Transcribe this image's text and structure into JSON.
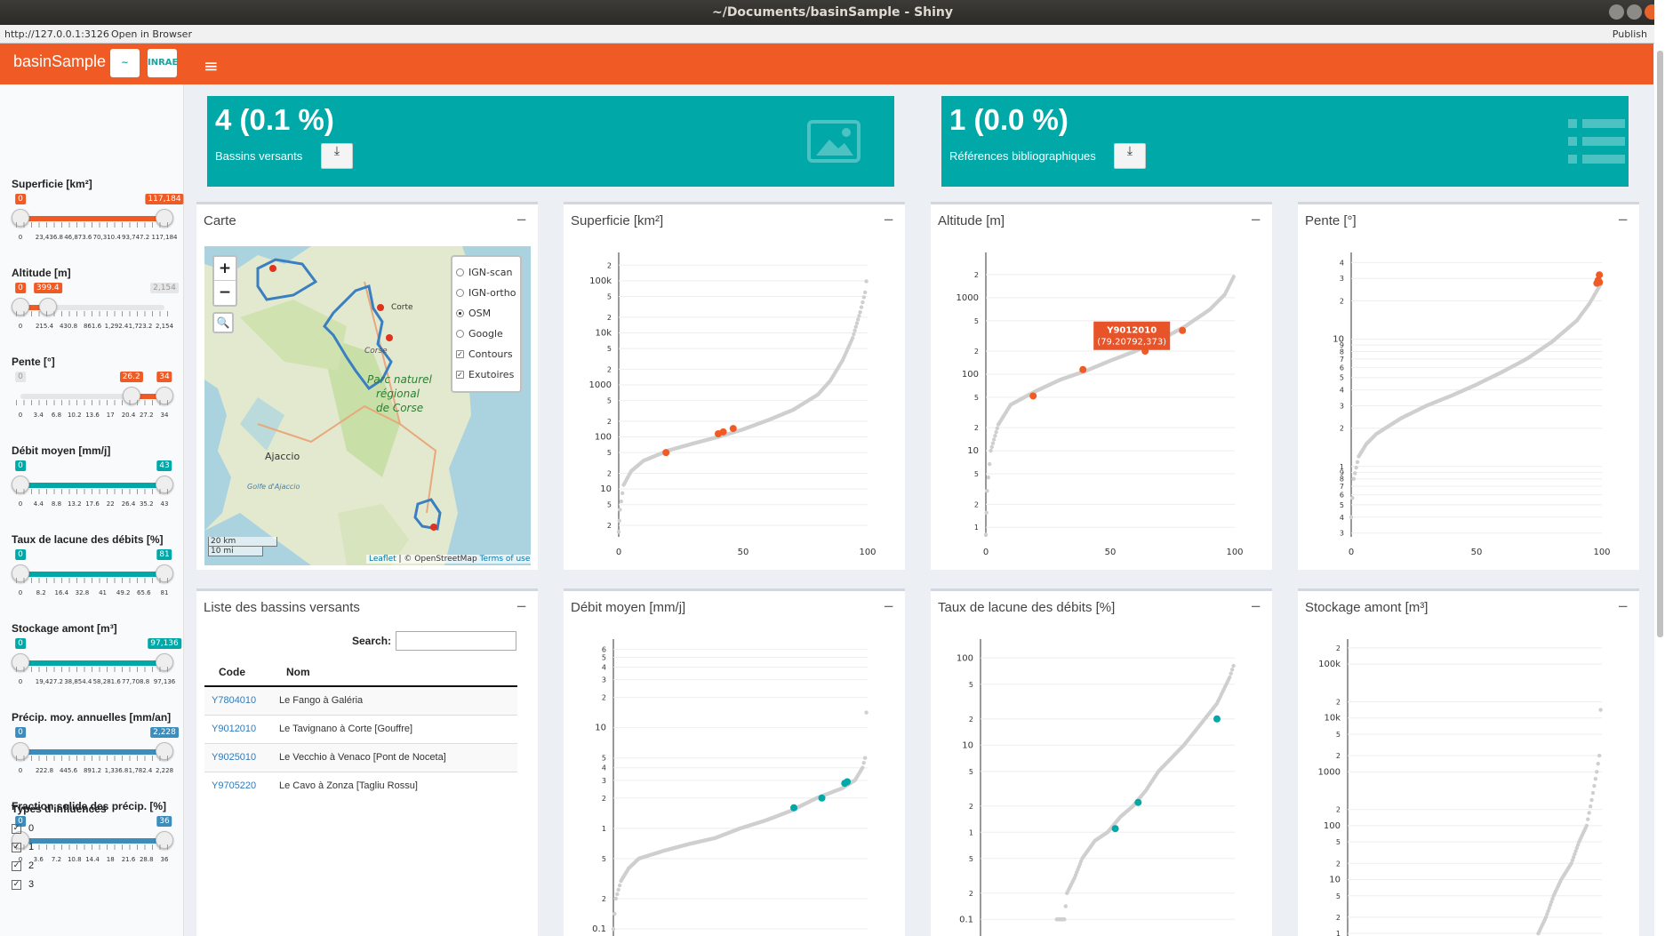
{
  "window": {
    "title": "~/Documents/basinSample - Shiny",
    "url": "http://127.0.0.1:3126",
    "open_in_browser": "Open in Browser",
    "publish": "Publish"
  },
  "header": {
    "app_name": "basinSample",
    "logo1": "~",
    "logo2": "INRAE"
  },
  "sidebar": {
    "sliders": [
      {
        "label": "Superficie [km²]",
        "low": "0",
        "high": "117,184",
        "ticks": [
          "0",
          "23,436.8",
          "46,873.6",
          "70,310.4",
          "93,747.2",
          "117,184"
        ],
        "from": 0,
        "to": 1,
        "color": "#f05a24"
      },
      {
        "label": "Altitude [m]",
        "low": "0",
        "high": "399.4",
        "max_label": "2,154",
        "ticks": [
          "0",
          "215.4",
          "430.8",
          "861.6",
          "1,292.4",
          "1,723.2",
          "2,154"
        ],
        "from": 0,
        "to": 0.19,
        "color": "#f05a24"
      },
      {
        "label": "Pente [°]",
        "low": "26.2",
        "high": "34",
        "min_label": "0",
        "ticks": [
          "0",
          "3.4",
          "6.8",
          "10.2",
          "13.6",
          "17",
          "20.4",
          "27.2",
          "34"
        ],
        "from": 0.77,
        "to": 1,
        "color": "#f05a24"
      },
      {
        "label": "Débit moyen [mm/j]",
        "low": "0",
        "high": "43",
        "ticks": [
          "0",
          "4.4",
          "8.8",
          "13.2",
          "17.6",
          "22",
          "26.4",
          "35.2",
          "43"
        ],
        "from": 0,
        "to": 1,
        "color": "#00a8a8"
      },
      {
        "label": "Taux de lacune des débits [%]",
        "low": "0",
        "high": "81",
        "ticks": [
          "0",
          "8.2",
          "16.4",
          "32.8",
          "41",
          "49.2",
          "65.6",
          "81"
        ],
        "from": 0,
        "to": 1,
        "color": "#00a8a8"
      },
      {
        "label": "Stockage amont [m³]",
        "low": "0",
        "high": "97,136",
        "ticks": [
          "0",
          "19,427.2",
          "38,854.4",
          "58,281.6",
          "77,708.8",
          "97,136"
        ],
        "from": 0,
        "to": 1,
        "color": "#00a8a8"
      },
      {
        "label": "Précip. moy. annuelles [mm/an]",
        "low": "0",
        "high": "2,228",
        "ticks": [
          "0",
          "222.8",
          "445.6",
          "891.2",
          "1,336.8",
          "1,782.4",
          "2,228"
        ],
        "from": 0,
        "to": 1,
        "color": "#3c8dbc"
      },
      {
        "label": "Fraction solide des précip. [%]",
        "low": "0",
        "high": "36",
        "ticks": [
          "0",
          "3.6",
          "7.2",
          "10.8",
          "14.4",
          "18",
          "21.6",
          "28.8",
          "36"
        ],
        "from": 0,
        "to": 1,
        "color": "#3c8dbc"
      }
    ],
    "influences": {
      "label": "Types d'influences",
      "options": [
        "0",
        "1",
        "2",
        "3"
      ]
    }
  },
  "value_boxes": [
    {
      "value": "4 (0.1 %)",
      "subtitle": "Bassins versants"
    },
    {
      "value": "1 (0.0 %)",
      "subtitle": "Références bibliographiques"
    }
  ],
  "map": {
    "title": "Carte",
    "layers": [
      "IGN-scan",
      "IGN-ortho",
      "OSM",
      "Google"
    ],
    "selected": "OSM",
    "overlays": [
      "Contours",
      "Exutoires"
    ],
    "places": [
      "Corse",
      "Parc naturel",
      "régional",
      "de Corse",
      "Ajaccio",
      "Golfe d'Ajaccio",
      "Corte"
    ],
    "scale_km": "20 km",
    "scale_mi": "10 mi",
    "attr_leaflet": "Leaflet",
    "attr_osm": "| © OpenStreetMap",
    "attr_terms": "Terms of use"
  },
  "table": {
    "title": "Liste des bassins versants",
    "search_label": "Search:",
    "columns": [
      "Code",
      "Nom"
    ],
    "rows": [
      [
        "Y7804010",
        "Le Fango à Galéria"
      ],
      [
        "Y9012010",
        "Le Tavignano à Corte [Gouffre]"
      ],
      [
        "Y9025010",
        "Le Vecchio à Venaco [Pont de Noceta]"
      ],
      [
        "Y9705220",
        "Le Cavo à Zonza [Tagliu Rossu]"
      ]
    ]
  },
  "chart_data": [
    {
      "type": "scatter",
      "title": "Superficie [km²]",
      "xlim": [
        0,
        100
      ],
      "xticks": [
        "0",
        "50",
        "100"
      ],
      "ylog": true,
      "yticks": [
        {
          "v": 2,
          "l": "2"
        },
        {
          "v": 5,
          "l": "5"
        },
        {
          "v": 10,
          "l": "10"
        },
        {
          "v": 20,
          "l": "2"
        },
        {
          "v": 50,
          "l": "5"
        },
        {
          "v": 100,
          "l": "100"
        },
        {
          "v": 200,
          "l": "2"
        },
        {
          "v": 500,
          "l": "5"
        },
        {
          "v": 1000,
          "l": "1000"
        },
        {
          "v": 2000,
          "l": "2"
        },
        {
          "v": 5000,
          "l": "5"
        },
        {
          "v": 10000,
          "l": "10k"
        },
        {
          "v": 20000,
          "l": "2"
        },
        {
          "v": 50000,
          "l": "5"
        },
        {
          "v": 100000,
          "l": "100k"
        },
        {
          "v": 200000,
          "l": "2"
        }
      ],
      "ylim": [
        1.2,
        300000
      ],
      "curve": [
        [
          0,
          1.5
        ],
        [
          0.5,
          4
        ],
        [
          2,
          12
        ],
        [
          5,
          22
        ],
        [
          10,
          35
        ],
        [
          20,
          55
        ],
        [
          30,
          75
        ],
        [
          40,
          100
        ],
        [
          50,
          140
        ],
        [
          60,
          210
        ],
        [
          70,
          330
        ],
        [
          80,
          650
        ],
        [
          85,
          1200
        ],
        [
          90,
          3000
        ],
        [
          94,
          8000
        ],
        [
          97,
          25000
        ],
        [
          99,
          60000
        ],
        [
          100,
          160000
        ]
      ],
      "highlight": [
        [
          19,
          50
        ],
        [
          40,
          115
        ],
        [
          42,
          125
        ],
        [
          46,
          145
        ]
      ],
      "highlight_color": "#f05a24"
    },
    {
      "type": "scatter",
      "title": "Altitude [m]",
      "xlim": [
        0,
        100
      ],
      "xticks": [
        "0",
        "50",
        "100"
      ],
      "ylog": true,
      "yticks": [
        {
          "v": 1,
          "l": "1"
        },
        {
          "v": 2,
          "l": "2"
        },
        {
          "v": 5,
          "l": "5"
        },
        {
          "v": 10,
          "l": "10"
        },
        {
          "v": 20,
          "l": "2"
        },
        {
          "v": 50,
          "l": "5"
        },
        {
          "v": 100,
          "l": "100"
        },
        {
          "v": 200,
          "l": "2"
        },
        {
          "v": 500,
          "l": "5"
        },
        {
          "v": 1000,
          "l": "1000"
        },
        {
          "v": 2000,
          "l": "2"
        }
      ],
      "ylim": [
        0.75,
        3500
      ],
      "curve": [
        [
          0,
          0.8
        ],
        [
          0.5,
          3
        ],
        [
          2,
          10
        ],
        [
          5,
          22
        ],
        [
          10,
          40
        ],
        [
          20,
          60
        ],
        [
          30,
          85
        ],
        [
          40,
          110
        ],
        [
          50,
          150
        ],
        [
          60,
          200
        ],
        [
          70,
          280
        ],
        [
          80,
          420
        ],
        [
          90,
          700
        ],
        [
          96,
          1100
        ],
        [
          100,
          2000
        ]
      ],
      "highlight": [
        [
          19,
          52
        ],
        [
          39,
          115
        ],
        [
          64,
          200
        ],
        [
          79,
          373
        ]
      ],
      "highlight_color": "#f05a24",
      "tooltip": {
        "code": "Y9012010",
        "value": "(79.20792,373)"
      }
    },
    {
      "type": "scatter",
      "title": "Pente [°]",
      "xlim": [
        0,
        100
      ],
      "xticks": [
        "0",
        "50",
        "100"
      ],
      "ylog": true,
      "yticks": [
        {
          "v": 0.3,
          "l": "3"
        },
        {
          "v": 0.4,
          "l": "4"
        },
        {
          "v": 0.5,
          "l": "5"
        },
        {
          "v": 0.6,
          "l": "6"
        },
        {
          "v": 0.7,
          "l": "7"
        },
        {
          "v": 0.8,
          "l": "8"
        },
        {
          "v": 0.9,
          "l": "9"
        },
        {
          "v": 1,
          "l": "1"
        },
        {
          "v": 2,
          "l": "2"
        },
        {
          "v": 3,
          "l": "3"
        },
        {
          "v": 4,
          "l": "4"
        },
        {
          "v": 5,
          "l": "5"
        },
        {
          "v": 6,
          "l": "6"
        },
        {
          "v": 7,
          "l": "7"
        },
        {
          "v": 8,
          "l": "8"
        },
        {
          "v": 9,
          "l": "9"
        },
        {
          "v": 10,
          "l": "10"
        },
        {
          "v": 20,
          "l": "2"
        },
        {
          "v": 30,
          "l": "3"
        },
        {
          "v": 40,
          "l": "4"
        }
      ],
      "ylim": [
        0.28,
        45
      ],
      "curve": [
        [
          0,
          0.4
        ],
        [
          1,
          0.8
        ],
        [
          3,
          1.2
        ],
        [
          6,
          1.5
        ],
        [
          10,
          1.8
        ],
        [
          20,
          2.4
        ],
        [
          30,
          3
        ],
        [
          40,
          3.6
        ],
        [
          50,
          4.4
        ],
        [
          60,
          5.5
        ],
        [
          70,
          7
        ],
        [
          80,
          9.5
        ],
        [
          90,
          14
        ],
        [
          95,
          19
        ],
        [
          100,
          28
        ]
      ],
      "highlight": [
        [
          98,
          27.5
        ],
        [
          98.5,
          29
        ],
        [
          99,
          32
        ],
        [
          99,
          28
        ]
      ],
      "highlight_color": "#f05a24"
    },
    {
      "type": "scatter",
      "title": "Débit moyen [mm/j]",
      "xlim": [
        0,
        100
      ],
      "xticks": [],
      "ylog": true,
      "yticks": [
        {
          "v": 0.1,
          "l": "0.1"
        },
        {
          "v": 0.2,
          "l": "2"
        },
        {
          "v": 0.5,
          "l": "5"
        },
        {
          "v": 1,
          "l": "1"
        },
        {
          "v": 2,
          "l": "2"
        },
        {
          "v": 3,
          "l": "3"
        },
        {
          "v": 4,
          "l": "4"
        },
        {
          "v": 5,
          "l": "5"
        },
        {
          "v": 10,
          "l": "10"
        },
        {
          "v": 20,
          "l": "2"
        },
        {
          "v": 30,
          "l": "3"
        },
        {
          "v": 40,
          "l": "4"
        },
        {
          "v": 50,
          "l": "5"
        },
        {
          "v": 60,
          "l": "6"
        }
      ],
      "ylim": [
        0.08,
        70
      ],
      "curve": [
        [
          0,
          0.1
        ],
        [
          1,
          0.2
        ],
        [
          3,
          0.3
        ],
        [
          6,
          0.4
        ],
        [
          10,
          0.5
        ],
        [
          20,
          0.6
        ],
        [
          30,
          0.7
        ],
        [
          40,
          0.8
        ],
        [
          50,
          1
        ],
        [
          60,
          1.2
        ],
        [
          70,
          1.5
        ],
        [
          80,
          2
        ],
        [
          90,
          2.5
        ],
        [
          95,
          3
        ],
        [
          98,
          4
        ],
        [
          99,
          5
        ],
        [
          100,
          40
        ]
      ],
      "highlight": [
        [
          71,
          1.6
        ],
        [
          82,
          2
        ],
        [
          91,
          2.8
        ],
        [
          92,
          2.9
        ]
      ],
      "highlight_color": "#00a8a8"
    },
    {
      "type": "scatter",
      "title": "Taux de lacune des débits [%]",
      "xlim": [
        0,
        100
      ],
      "xticks": [],
      "ylog": true,
      "yticks": [
        {
          "v": 0.1,
          "l": "0.1"
        },
        {
          "v": 0.2,
          "l": "2"
        },
        {
          "v": 0.5,
          "l": "5"
        },
        {
          "v": 1,
          "l": "1"
        },
        {
          "v": 2,
          "l": "2"
        },
        {
          "v": 5,
          "l": "5"
        },
        {
          "v": 10,
          "l": "10"
        },
        {
          "v": 20,
          "l": "2"
        },
        {
          "v": 50,
          "l": "5"
        },
        {
          "v": 100,
          "l": "100"
        }
      ],
      "ylim": [
        0.06,
        150
      ],
      "curve": [
        [
          30,
          0.1
        ],
        [
          33,
          0.1
        ],
        [
          34,
          0.2
        ],
        [
          37,
          0.3
        ],
        [
          40,
          0.5
        ],
        [
          45,
          0.8
        ],
        [
          50,
          1
        ],
        [
          55,
          1.5
        ],
        [
          60,
          2
        ],
        [
          65,
          3
        ],
        [
          70,
          5
        ],
        [
          80,
          10
        ],
        [
          87,
          18
        ],
        [
          93,
          30
        ],
        [
          98,
          60
        ],
        [
          100,
          90
        ]
      ],
      "highlight": [
        [
          53,
          1.1
        ],
        [
          62,
          2.2
        ],
        [
          93,
          20
        ]
      ],
      "highlight_color": "#00a8a8"
    },
    {
      "type": "scatter",
      "title": "Stockage amont [m³]",
      "xlim": [
        0,
        100
      ],
      "xticks": [],
      "ylog": true,
      "yticks": [
        {
          "v": 1,
          "l": "1"
        },
        {
          "v": 2,
          "l": "2"
        },
        {
          "v": 5,
          "l": "5"
        },
        {
          "v": 10,
          "l": "10"
        },
        {
          "v": 20,
          "l": "2"
        },
        {
          "v": 50,
          "l": "5"
        },
        {
          "v": 100,
          "l": "100"
        },
        {
          "v": 200,
          "l": "2"
        },
        {
          "v": 1000,
          "l": "1000"
        },
        {
          "v": 2000,
          "l": "2"
        },
        {
          "v": 5000,
          "l": "5"
        },
        {
          "v": 10000,
          "l": "10k"
        },
        {
          "v": 20000,
          "l": "2"
        },
        {
          "v": 100000,
          "l": "100k"
        },
        {
          "v": 200000,
          "l": "2"
        }
      ],
      "ylim": [
        0.8,
        250000
      ],
      "curve": [
        [
          75,
          1
        ],
        [
          78,
          2
        ],
        [
          81,
          5
        ],
        [
          84,
          10
        ],
        [
          88,
          20
        ],
        [
          91,
          50
        ],
        [
          94,
          100
        ],
        [
          96,
          300
        ],
        [
          98,
          1000
        ],
        [
          99,
          2000
        ],
        [
          100,
          100000
        ]
      ],
      "highlight": [],
      "highlight_color": "#00a8a8"
    }
  ]
}
